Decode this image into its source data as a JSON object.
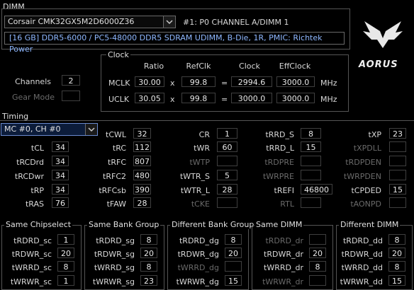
{
  "dimm": {
    "group_label": "DIMM",
    "module": "Corsair CMK32GX5M2D6000Z36",
    "slot": "#1: P0 CHANNEL A/DIMM 1",
    "info": "[16 GB] DDR5-6000 / PC5-48000 DDR5 SDRAM UDIMM, B-Die, 1R, PMIC: Richtek Power"
  },
  "logo": {
    "text": "AORUS"
  },
  "left": {
    "channels_label": "Channels",
    "channels_value": "2",
    "gear_label": "Gear Mode",
    "gear_value": ""
  },
  "clock": {
    "title": "Clock",
    "headers": {
      "ratio": "Ratio",
      "refclk": "RefClk",
      "clock": "Clock",
      "effclock": "EffClock"
    },
    "rows": [
      {
        "label": "MCLK",
        "ratio": "30.00",
        "x": "x",
        "refclk": "99.8",
        "eq": "=",
        "clock": "2994.6",
        "effclock": "3000.0",
        "unit": "MHz"
      },
      {
        "label": "UCLK",
        "ratio": "30.05",
        "x": "x",
        "refclk": "99.8",
        "eq": "=",
        "clock": "3000.0",
        "effclock": "3000.0",
        "unit": "MHz"
      }
    ]
  },
  "timing": {
    "title": "Timing",
    "selector": "MC #0, CH #0",
    "items": {
      "tCWL": {
        "label": "tCWL",
        "value": "32"
      },
      "CR": {
        "label": "CR",
        "value": "1"
      },
      "tRRD_S": {
        "label": "tRRD_S",
        "value": "8"
      },
      "tXP": {
        "label": "tXP",
        "value": "23"
      },
      "tCL": {
        "label": "tCL",
        "value": "34"
      },
      "tRC": {
        "label": "tRC",
        "value": "112"
      },
      "tWR": {
        "label": "tWR",
        "value": "60"
      },
      "tRRD_L": {
        "label": "tRRD_L",
        "value": "15"
      },
      "tXPDLL": {
        "label": "tXPDLL",
        "value": ""
      },
      "tRCDrd": {
        "label": "tRCDrd",
        "value": "34"
      },
      "tRFC": {
        "label": "tRFC",
        "value": "807"
      },
      "tWTP": {
        "label": "tWTP",
        "value": ""
      },
      "tRDPRE": {
        "label": "tRDPRE",
        "value": ""
      },
      "tRDPDEN": {
        "label": "tRDPDEN",
        "value": ""
      },
      "tRCDwr": {
        "label": "tRCDwr",
        "value": "34"
      },
      "tRFC2": {
        "label": "tRFC2",
        "value": "480"
      },
      "tWTR_S": {
        "label": "tWTR_S",
        "value": "5"
      },
      "tWRPRE": {
        "label": "tWRPRE",
        "value": ""
      },
      "tWRPDEN": {
        "label": "tWRPDEN",
        "value": ""
      },
      "tRP": {
        "label": "tRP",
        "value": "34"
      },
      "tRFCsb": {
        "label": "tRFCsb",
        "value": "390"
      },
      "tWTR_L": {
        "label": "tWTR_L",
        "value": "28"
      },
      "tREFI": {
        "label": "tREFI",
        "value": "46800"
      },
      "tCPDED": {
        "label": "tCPDED",
        "value": "15"
      },
      "tRAS": {
        "label": "tRAS",
        "value": "76"
      },
      "tFAW": {
        "label": "tFAW",
        "value": "28"
      },
      "tCKE": {
        "label": "tCKE",
        "value": ""
      },
      "RTL": {
        "label": "RTL",
        "value": ""
      },
      "tAONPD": {
        "label": "tAONPD",
        "value": ""
      }
    }
  },
  "groups": [
    {
      "title": "Same Chipselect",
      "rows": [
        {
          "label": "tRDRD_sc",
          "value": "1"
        },
        {
          "label": "tRDWR_sc",
          "value": "20"
        },
        {
          "label": "tWRRD_sc",
          "value": "8"
        },
        {
          "label": "tWRWR_sc",
          "value": "1"
        }
      ]
    },
    {
      "title": "Same Bank Group",
      "rows": [
        {
          "label": "tRDRD_sg",
          "value": "8"
        },
        {
          "label": "tRDWR_sg",
          "value": "20"
        },
        {
          "label": "tWRRD_sg",
          "value": "8"
        },
        {
          "label": "tWRWR_sg",
          "value": "23"
        }
      ]
    },
    {
      "title": "Different Bank Group",
      "rows": [
        {
          "label": "tRDRD_dg",
          "value": "8"
        },
        {
          "label": "tRDWR_dg",
          "value": "20"
        },
        {
          "label": "tWRRD_dg",
          "value": ""
        },
        {
          "label": "tWRWR_dg",
          "value": "15"
        }
      ]
    },
    {
      "title": "Same DIMM",
      "rows": [
        {
          "label": "tRDRD_dr",
          "value": ""
        },
        {
          "label": "tRDWR_dr",
          "value": "20"
        },
        {
          "label": "tWRRD_dr",
          "value": "8"
        },
        {
          "label": "tWRWR_dr",
          "value": ""
        }
      ]
    },
    {
      "title": "Different DIMM",
      "rows": [
        {
          "label": "tRDRD_dd",
          "value": "8"
        },
        {
          "label": "tRDWR_dd",
          "value": "20"
        },
        {
          "label": "tWRRD_dd",
          "value": "8"
        },
        {
          "label": "tWRWR_dd",
          "value": "15"
        }
      ]
    }
  ]
}
